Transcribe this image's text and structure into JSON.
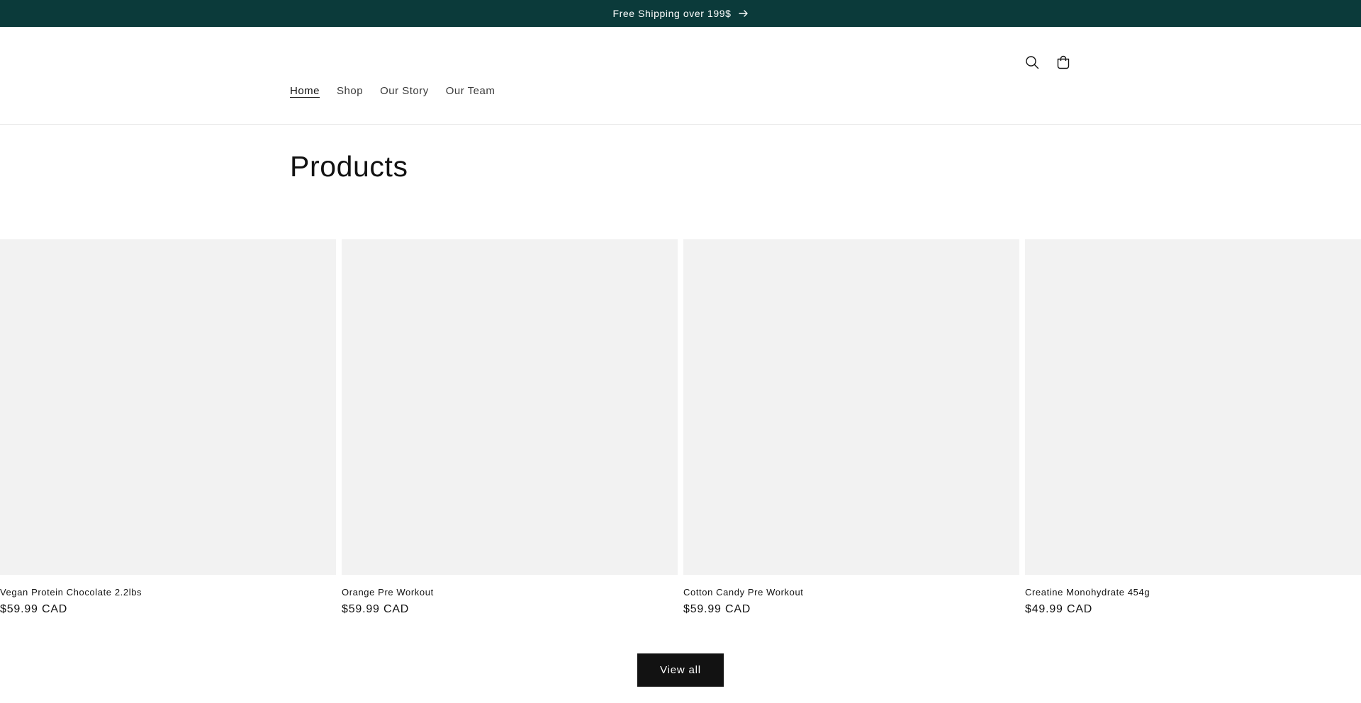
{
  "announcement": {
    "text": "Free Shipping over 199$",
    "icon": "arrow-right-icon"
  },
  "header": {
    "icons": [
      "search-icon",
      "cart-icon"
    ],
    "nav": [
      {
        "label": "Home",
        "active": true
      },
      {
        "label": "Shop",
        "active": false
      },
      {
        "label": "Our Story",
        "active": false
      },
      {
        "label": "Our Team",
        "active": false
      }
    ]
  },
  "main": {
    "title": "Products",
    "products": [
      {
        "title": "Vegan Protein Chocolate 2.2lbs",
        "price": "$59.99 CAD"
      },
      {
        "title": "Orange Pre Workout",
        "price": "$59.99 CAD"
      },
      {
        "title": "Cotton Candy Pre Workout",
        "price": "$59.99 CAD"
      },
      {
        "title": "Creatine Monohydrate 454g",
        "price": "$49.99 CAD"
      }
    ],
    "view_all_label": "View all"
  },
  "colors": {
    "announcement_bg": "#0b3a3a",
    "button_bg": "#121212",
    "image_placeholder": "#f2f2f2"
  }
}
